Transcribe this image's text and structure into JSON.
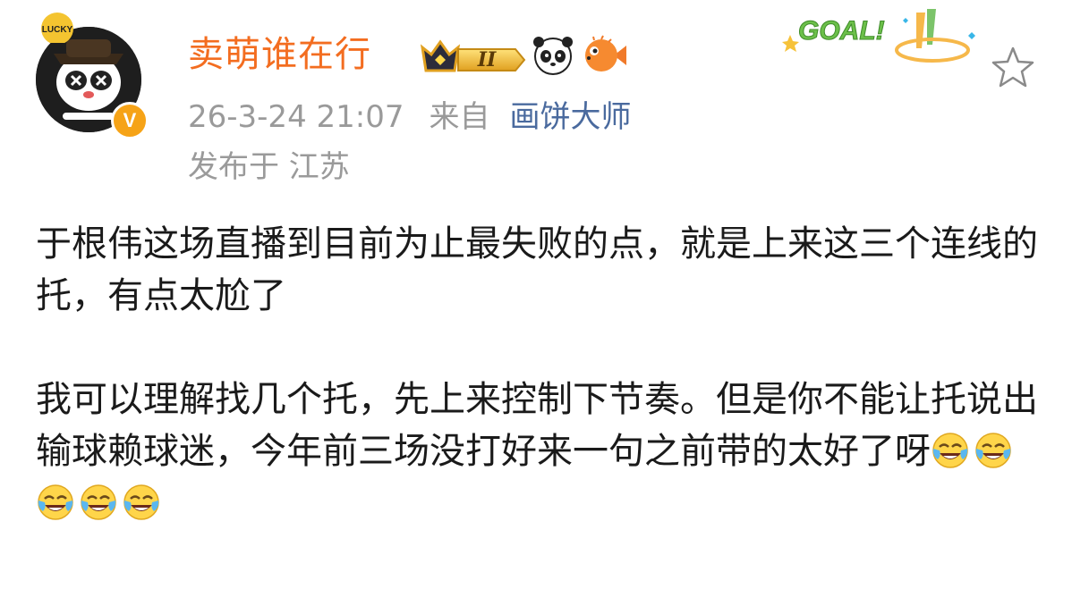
{
  "user": {
    "name": "卖萌谁在行",
    "verified_badge": "V",
    "level_badge": "II",
    "icons": [
      "crown-level-icon",
      "panda-icon",
      "pufferfish-icon"
    ]
  },
  "post_meta": {
    "timestamp": "26-3-24 21:07",
    "from_label": "来自",
    "source": "画饼大师",
    "location": "发布于 江苏"
  },
  "decoration": {
    "goal_text": "GOAL!"
  },
  "post": {
    "paragraph_1": "于根伟这场直播到目前为止最失败的点，就是上来这三个连线的托，有点太尬了",
    "paragraph_2": "我可以理解找几个托，先上来控制下节奏。但是你不能让托说出输球赖球迷，今年前三场没打好来一句之前带的太好了呀",
    "trailing_emoji_count": 5,
    "emoji_name": "laugh-cry-emoji"
  },
  "colors": {
    "username": "#f36d20",
    "meta": "#9a9a9a",
    "source_link": "#4a6a9e",
    "body_text": "#1a1a1a",
    "verified_badge": "#f6a317"
  }
}
